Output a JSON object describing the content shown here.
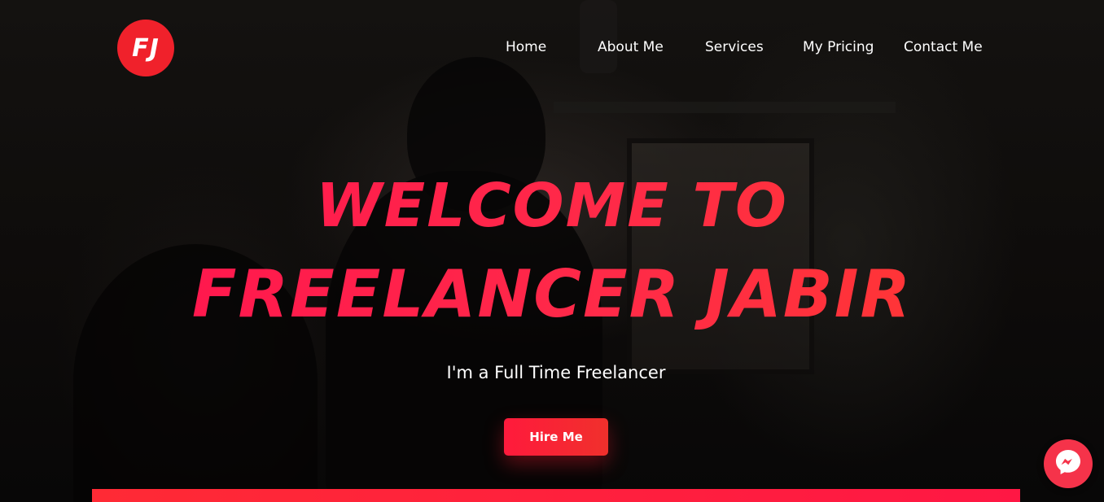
{
  "brand": {
    "logo_text": "FJ",
    "accent_color": "#f0212b"
  },
  "nav": {
    "items": [
      {
        "label": "Home"
      },
      {
        "label": "About Me"
      },
      {
        "label": "Services"
      },
      {
        "label": "My Pricing"
      },
      {
        "label": "Contact Me"
      }
    ]
  },
  "hero": {
    "headline_line1": "Welcome to",
    "headline_line2": "Freelancer Jabir",
    "subtitle": "I'm a Full Time Freelancer",
    "cta_label": "Hire Me"
  },
  "widgets": {
    "chat_icon": "messenger-icon"
  }
}
